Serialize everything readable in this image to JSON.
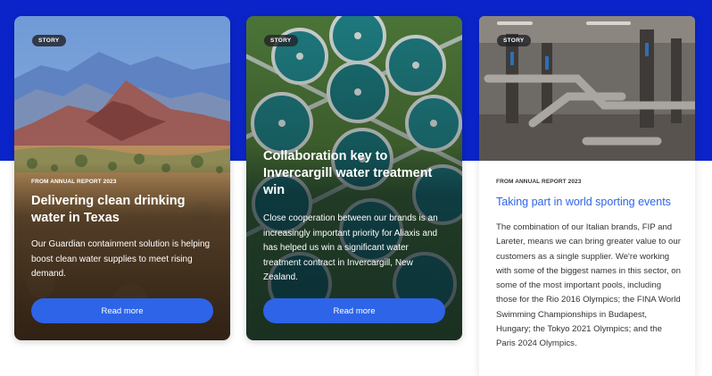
{
  "colors": {
    "band": "#0b24c9",
    "accent": "#2d64e8"
  },
  "cards": [
    {
      "badge": "STORY",
      "eyebrow": "FROM ANNUAL REPORT 2023",
      "title": "Delivering clean drinking water in Texas",
      "body": "Our Guardian containment solution is helping boost clean water supplies to meet rising demand.",
      "button": "Read more"
    },
    {
      "badge": "STORY",
      "title": "Collaboration key to Invercargill water treatment win",
      "body": "Close cooperation between our brands is an increasingly important priority for Aliaxis and has helped us win a significant water treatment contract in Invercargill, New Zealand.",
      "button": "Read more"
    },
    {
      "badge": "STORY",
      "eyebrow": "FROM ANNUAL REPORT 2023",
      "title": "Taking part in world sporting events",
      "body": "The combination of our Italian brands, FIP and Lareter, means we can bring greater value to our customers as a single supplier. We're working with some of the biggest names in this sector, on some of the most important pools, including those for the Rio 2016 Olympics; the FINA World Swimming Championships in Budapest, Hungary; the Tokyo 2021 Olympics; and the Paris 2024 Olympics."
    }
  ]
}
